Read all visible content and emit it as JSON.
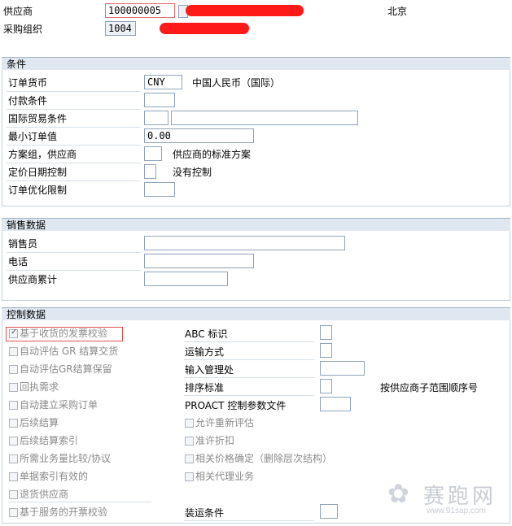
{
  "header": {
    "vendor_label": "供应商",
    "vendor_value": "100000005",
    "city": "北京",
    "purch_org_label": "采购组织",
    "purch_org_value": "1004"
  },
  "conditions": {
    "title": "条件",
    "order_currency_label": "订单货币",
    "order_currency_value": "CNY",
    "order_currency_desc": "中国人民币（国际）",
    "payment_terms_label": "付款条件",
    "incoterms_label": "国际贸易条件",
    "min_order_label": "最小订单值",
    "min_order_value": "0.00",
    "schema_group_label": "方案组，供应商",
    "schema_group_desc": "供应商的标准方案",
    "pricing_date_label": "定价日期控制",
    "pricing_date_desc": "没有控制",
    "order_opt_label": "订单优化限制"
  },
  "sales": {
    "title": "销售数据",
    "salesperson_label": "销售员",
    "phone_label": "电话",
    "vendor_acc_label": "供应商累计"
  },
  "control": {
    "title": "控制数据",
    "left_checks": [
      {
        "label": "基于收货的发票校验",
        "checked": true
      },
      {
        "label": "自动评估 GR 结算交货",
        "checked": false
      },
      {
        "label": "自动评估GR结算保留",
        "checked": false
      },
      {
        "label": "回执需求",
        "checked": false
      },
      {
        "label": "自动建立采购订单",
        "checked": false
      },
      {
        "label": "后续结算",
        "checked": false
      },
      {
        "label": "后续结算索引",
        "checked": false
      },
      {
        "label": "所需业务量比较/协议",
        "checked": false
      },
      {
        "label": "单据索引有效的",
        "checked": false
      },
      {
        "label": "退货供应商",
        "checked": false
      },
      {
        "label": "基于服务的开票校验",
        "checked": false
      }
    ],
    "abc_label": "ABC 标识",
    "transport_label": "运输方式",
    "import_office_label": "输入管理处",
    "sort_criteria_label": "排序标准",
    "sort_criteria_desc": "按供应商子范围顺序号",
    "proact_label": "PROACT 控制参数文件",
    "reeval_label": "允许重新评估",
    "discount_label": "准许折扣",
    "price_det_label": "相关价格确定（删除层次结构）",
    "agency_label": "相关代理业务",
    "shipping_label": "装运条件"
  },
  "watermark": {
    "text": "赛跑网",
    "url": "www.91sap.com"
  }
}
